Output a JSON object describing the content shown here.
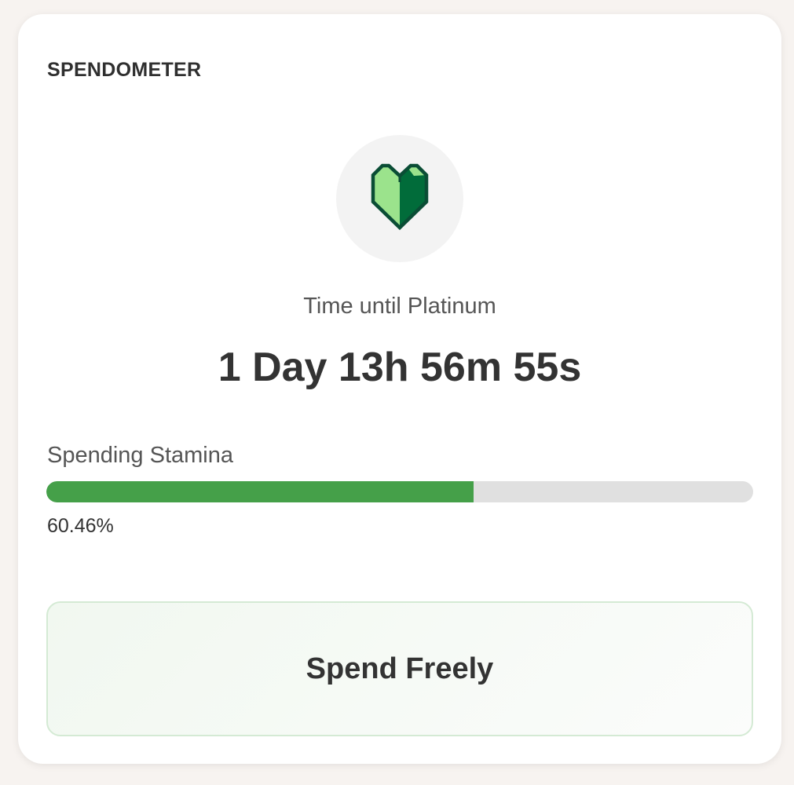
{
  "widget": {
    "title": "SPENDOMETER",
    "icon": "green-heart-icon",
    "subtitle": "Time until Platinum",
    "countdown": "1 Day 13h 56m 55s"
  },
  "stamina": {
    "label": "Spending Stamina",
    "percent_text": "60.46%",
    "value": 0.6046
  },
  "status": {
    "message": "Spend Freely"
  },
  "colors": {
    "progress_fill": "#45a049",
    "progress_track": "#e0e0e0",
    "heart_light": "#9be38c",
    "heart_dark": "#016c3a",
    "heart_outline": "#0a4d35"
  }
}
